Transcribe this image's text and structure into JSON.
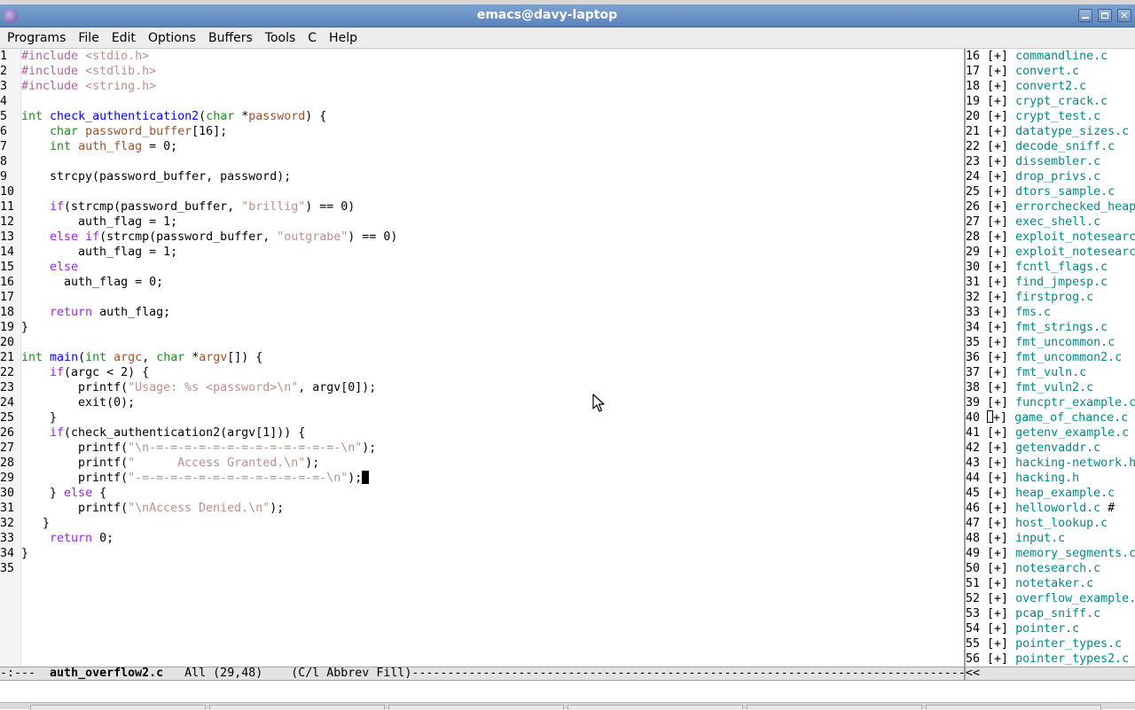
{
  "window": {
    "title": "emacs@davy-laptop"
  },
  "menubar": {
    "items": [
      "Programs",
      "File",
      "Edit",
      "Options",
      "Buffers",
      "Tools",
      "C",
      "Help"
    ]
  },
  "editor": {
    "lines": [
      [
        {
          "t": "#include ",
          "c": "pp"
        },
        {
          "t": "<stdio.h>",
          "c": "st"
        }
      ],
      [
        {
          "t": "#include ",
          "c": "pp"
        },
        {
          "t": "<stdlib.h>",
          "c": "st"
        }
      ],
      [
        {
          "t": "#include ",
          "c": "pp"
        },
        {
          "t": "<string.h>",
          "c": "st"
        }
      ],
      [],
      [
        {
          "t": "int",
          "c": "ty"
        },
        {
          "t": " "
        },
        {
          "t": "check_authentication2",
          "c": "fn"
        },
        {
          "t": "("
        },
        {
          "t": "char",
          "c": "ty"
        },
        {
          "t": " *"
        },
        {
          "t": "password",
          "c": "vr"
        },
        {
          "t": ") {"
        }
      ],
      [
        {
          "t": "    "
        },
        {
          "t": "char",
          "c": "ty"
        },
        {
          "t": " "
        },
        {
          "t": "password_buffer",
          "c": "vr"
        },
        {
          "t": "[16];"
        }
      ],
      [
        {
          "t": "    "
        },
        {
          "t": "int",
          "c": "ty"
        },
        {
          "t": " "
        },
        {
          "t": "auth_flag",
          "c": "vr"
        },
        {
          "t": " = 0;"
        }
      ],
      [],
      [
        {
          "t": "    strcpy(password_buffer, password);"
        }
      ],
      [],
      [
        {
          "t": "    "
        },
        {
          "t": "if",
          "c": "kw"
        },
        {
          "t": "(strcmp(password_buffer, "
        },
        {
          "t": "\"brillig\"",
          "c": "st"
        },
        {
          "t": ") == 0)"
        }
      ],
      [
        {
          "t": "        auth_flag = 1;"
        }
      ],
      [
        {
          "t": "    "
        },
        {
          "t": "else",
          "c": "kw"
        },
        {
          "t": " "
        },
        {
          "t": "if",
          "c": "kw"
        },
        {
          "t": "(strcmp(password_buffer, "
        },
        {
          "t": "\"outgrabe\"",
          "c": "st"
        },
        {
          "t": ") == 0)"
        }
      ],
      [
        {
          "t": "        auth_flag = 1;"
        }
      ],
      [
        {
          "t": "    "
        },
        {
          "t": "else",
          "c": "kw"
        }
      ],
      [
        {
          "t": "      auth_flag = 0;"
        }
      ],
      [],
      [
        {
          "t": "    "
        },
        {
          "t": "return",
          "c": "kw"
        },
        {
          "t": " auth_flag;"
        }
      ],
      [
        {
          "t": "}"
        }
      ],
      [],
      [
        {
          "t": "int",
          "c": "ty"
        },
        {
          "t": " "
        },
        {
          "t": "main",
          "c": "fn"
        },
        {
          "t": "("
        },
        {
          "t": "int",
          "c": "ty"
        },
        {
          "t": " "
        },
        {
          "t": "argc",
          "c": "vr"
        },
        {
          "t": ", "
        },
        {
          "t": "char",
          "c": "ty"
        },
        {
          "t": " *"
        },
        {
          "t": "argv",
          "c": "vr"
        },
        {
          "t": "[]) {"
        }
      ],
      [
        {
          "t": "    "
        },
        {
          "t": "if",
          "c": "kw"
        },
        {
          "t": "(argc < 2) {"
        }
      ],
      [
        {
          "t": "        printf("
        },
        {
          "t": "\"Usage: %s <password>\\n\"",
          "c": "st"
        },
        {
          "t": ", argv[0]);"
        }
      ],
      [
        {
          "t": "        exit(0);"
        }
      ],
      [
        {
          "t": "    }"
        }
      ],
      [
        {
          "t": "    "
        },
        {
          "t": "if",
          "c": "kw"
        },
        {
          "t": "(check_authentication2(argv[1])) {"
        }
      ],
      [
        {
          "t": "        printf("
        },
        {
          "t": "\"\\n-=-=-=-=-=-=-=-=-=-=-=-=-=-\\n\"",
          "c": "st"
        },
        {
          "t": ");"
        }
      ],
      [
        {
          "t": "        printf("
        },
        {
          "t": "\"      Access Granted.\\n\"",
          "c": "st"
        },
        {
          "t": ");"
        }
      ],
      [
        {
          "t": "        printf("
        },
        {
          "t": "\"-=-=-=-=-=-=-=-=-=-=-=-=-=-\\n\"",
          "c": "st"
        },
        {
          "t": ");"
        },
        {
          "cursor": true
        }
      ],
      [
        {
          "t": "    } "
        },
        {
          "t": "else",
          "c": "kw"
        },
        {
          "t": " {"
        }
      ],
      [
        {
          "t": "        printf("
        },
        {
          "t": "\"\\nAccess Denied.\\n\"",
          "c": "st"
        },
        {
          "t": ");"
        }
      ],
      [
        {
          "t": "   }"
        }
      ],
      [
        {
          "t": "    "
        },
        {
          "t": "return",
          "c": "kw"
        },
        {
          "t": " 0;"
        }
      ],
      [
        {
          "t": "}"
        }
      ],
      []
    ]
  },
  "ibuffer": {
    "rows": [
      {
        "n": "16",
        "name": "commandline.c"
      },
      {
        "n": "17",
        "name": "convert.c"
      },
      {
        "n": "18",
        "name": "convert2.c"
      },
      {
        "n": "19",
        "name": "crypt_crack.c"
      },
      {
        "n": "20",
        "name": "crypt_test.c"
      },
      {
        "n": "21",
        "name": "datatype_sizes.c"
      },
      {
        "n": "22",
        "name": "decode_sniff.c"
      },
      {
        "n": "23",
        "name": "dissembler.c"
      },
      {
        "n": "24",
        "name": "drop_privs.c"
      },
      {
        "n": "25",
        "name": "dtors_sample.c"
      },
      {
        "n": "26",
        "name": "errorchecked_heap"
      },
      {
        "n": "27",
        "name": "exec_shell.c"
      },
      {
        "n": "28",
        "name": "exploit_notesearc"
      },
      {
        "n": "29",
        "name": "exploit_notesearc"
      },
      {
        "n": "30",
        "name": "fcntl_flags.c"
      },
      {
        "n": "31",
        "name": "find_jmpesp.c"
      },
      {
        "n": "32",
        "name": "firstprog.c"
      },
      {
        "n": "33",
        "name": "fms.c"
      },
      {
        "n": "34",
        "name": "fmt_strings.c"
      },
      {
        "n": "35",
        "name": "fmt_uncommon.c"
      },
      {
        "n": "36",
        "name": "fmt_uncommon2.c"
      },
      {
        "n": "37",
        "name": "fmt_vuln.c"
      },
      {
        "n": "38",
        "name": "fmt_vuln2.c"
      },
      {
        "n": "39",
        "name": "funcptr_example.c"
      },
      {
        "n": "40",
        "name": "game_of_chance.c",
        "cursor": true
      },
      {
        "n": "41",
        "name": "getenv_example.c"
      },
      {
        "n": "42",
        "name": "getenvaddr.c"
      },
      {
        "n": "43",
        "name": "hacking-network.h"
      },
      {
        "n": "44",
        "name": "hacking.h"
      },
      {
        "n": "45",
        "name": "heap_example.c"
      },
      {
        "n": "46",
        "name": "helloworld.c",
        "suffix": " #"
      },
      {
        "n": "47",
        "name": "host_lookup.c"
      },
      {
        "n": "48",
        "name": "input.c"
      },
      {
        "n": "49",
        "name": "memory_segments.c"
      },
      {
        "n": "50",
        "name": "notesearch.c"
      },
      {
        "n": "51",
        "name": "notetaker.c"
      },
      {
        "n": "52",
        "name": "overflow_example."
      },
      {
        "n": "53",
        "name": "pcap_sniff.c"
      },
      {
        "n": "54",
        "name": "pointer.c"
      },
      {
        "n": "55",
        "name": "pointer_types.c"
      },
      {
        "n": "56",
        "name": "pointer_types2.c"
      }
    ]
  },
  "modeline": {
    "status": "-:---  ",
    "buffer": "auth_overflow2.c",
    "position": "   All (29,48)    ",
    "modes": "(C/l Abbrev Fill)",
    "fill": "------------------------------------------------------------------------------------------------------------------------------------",
    "right": "<<"
  },
  "colors": {
    "keyword": "#a020f0",
    "type": "#228b22",
    "function": "#0000ff",
    "variable": "#a0522d",
    "string": "#bc8f8f",
    "preprocessor": "#b0649f",
    "buffer-name": "#008b8b"
  },
  "icons": [
    "emacs-icon",
    "minimize-icon",
    "maximize-icon",
    "close-icon",
    "mouse-pointer-icon"
  ]
}
